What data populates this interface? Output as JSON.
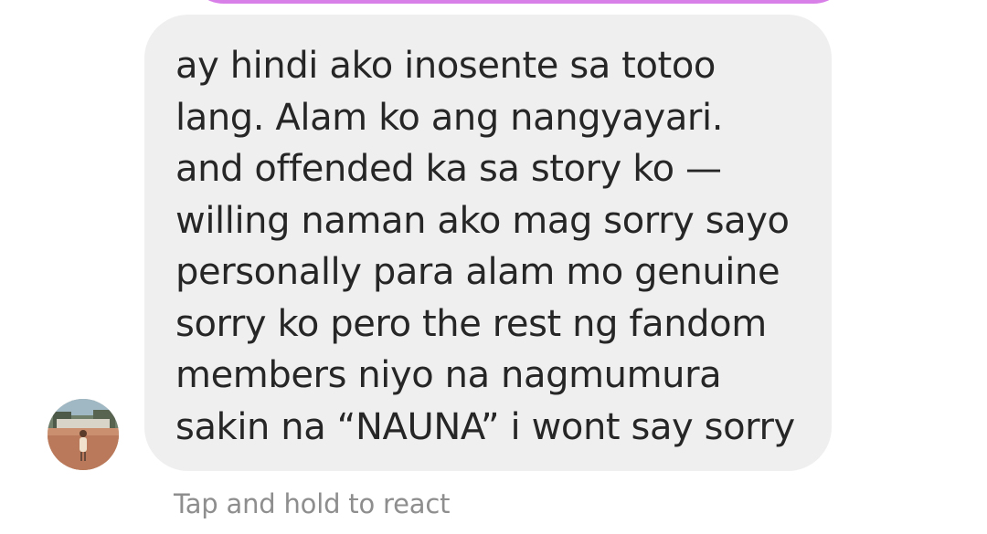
{
  "thread": {
    "incoming_message": {
      "text": "ay hindi ako inosente sa totoo\nlang. Alam ko ang nangyayari.\nand offended ka sa story ko —\nwilling naman ako mag sorry sayo\npersonally para alam mo genuine\nsorry ko pero the rest ng fandom\nmembers niyo na nagmumura\nsakin na “NAUNA” i wont say sorry"
    },
    "react_hint": "Tap and hold to react",
    "colors": {
      "sent_bubble_accent": "#d97fe8",
      "incoming_bubble_bg": "#efefef",
      "message_text": "#262626",
      "hint_text": "#8e8e8e"
    },
    "icons": {
      "avatar": "sender-avatar-photo"
    }
  }
}
